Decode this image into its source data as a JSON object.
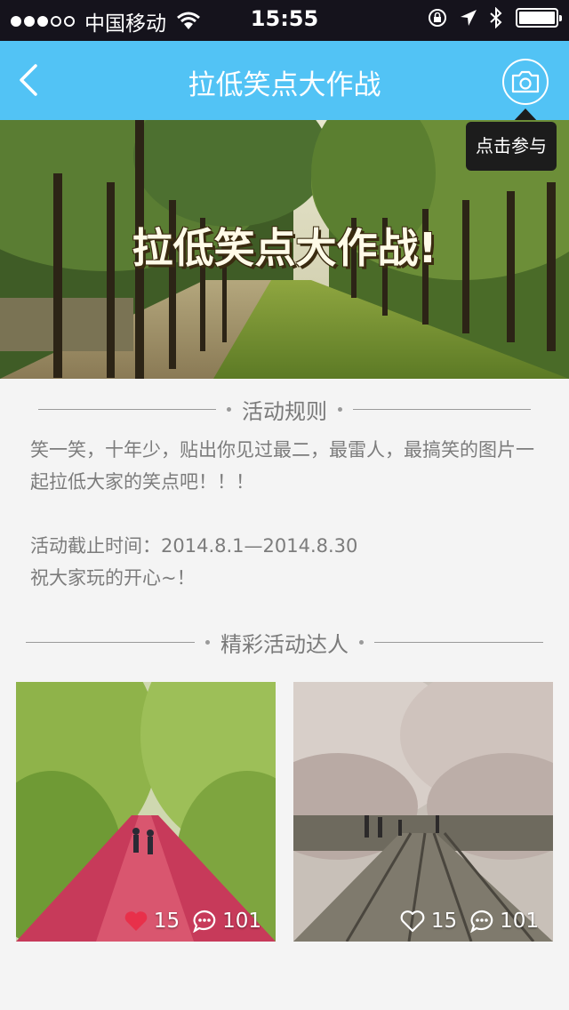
{
  "status_bar": {
    "carrier": "中国移动",
    "time": "15:55"
  },
  "nav": {
    "title": "拉低笑点大作战",
    "tooltip": "点击参与"
  },
  "banner": {
    "title": "拉低笑点大作战!"
  },
  "rules": {
    "heading": "活动规则",
    "paragraph1": "笑一笑，十年少，贴出你见过最二，最雷人，最搞笑的图片一起拉低大家的笑点吧！！！",
    "deadline": "活动截止时间：2014.8.1—2014.8.30",
    "closing": "祝大家玩的开心~！"
  },
  "featured": {
    "heading": "精彩活动达人",
    "posts": [
      {
        "likes": "15",
        "comments": "101",
        "liked": true
      },
      {
        "likes": "15",
        "comments": "101",
        "liked": false
      }
    ]
  },
  "colors": {
    "nav_bg": "#52c3f5",
    "status_bg": "#15131c",
    "like_red": "#e8304a"
  }
}
